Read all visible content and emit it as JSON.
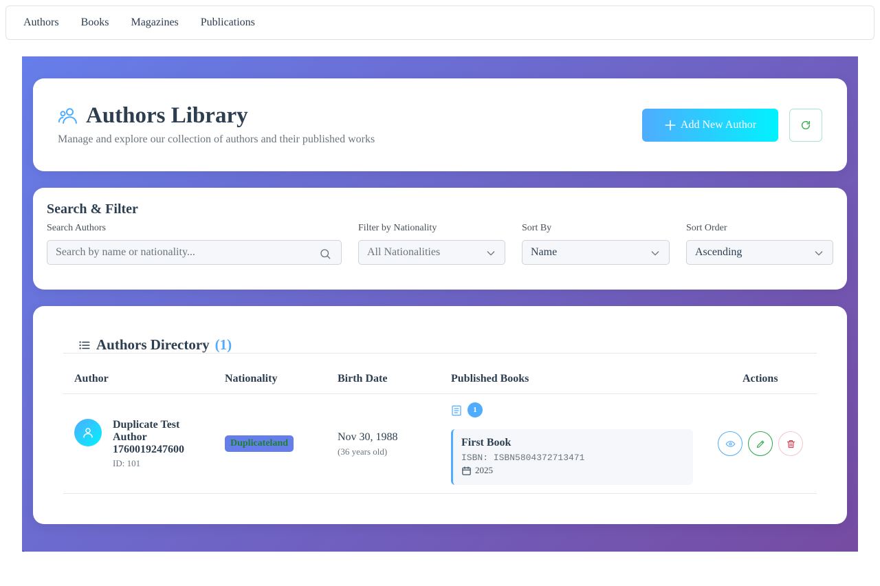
{
  "nav": {
    "items": [
      "Authors",
      "Books",
      "Magazines",
      "Publications"
    ]
  },
  "stray_char": "`",
  "header": {
    "title": "Authors Library",
    "subtitle": "Manage and explore our collection of authors and their published works",
    "add_button": "Add New Author"
  },
  "filters": {
    "title": "Search & Filter",
    "search_label": "Search Authors",
    "search_placeholder": "Search by name or nationality...",
    "nationality_label": "Filter by Nationality",
    "nationality_value": "All Nationalities",
    "sortby_label": "Sort By",
    "sortby_value": "Name",
    "sortorder_label": "Sort Order",
    "sortorder_value": "Ascending"
  },
  "directory": {
    "title": "Authors Directory",
    "count": "(1)",
    "columns": {
      "author": "Author",
      "nationality": "Nationality",
      "birth": "Birth Date",
      "books": "Published Books",
      "actions": "Actions"
    },
    "rows": [
      {
        "name": "Duplicate Test Author 1760019247600",
        "id": "ID: 101",
        "nationality": "Duplicateland",
        "birth_date": "Nov 30, 1988",
        "age": "(36 years old)",
        "book_count": "1",
        "book": {
          "title": "First Book",
          "isbn": "ISBN: ISBN5804372713471",
          "year": "2025"
        }
      }
    ]
  },
  "colors": {
    "gradient_start": "#667eea",
    "gradient_end": "#764ba2",
    "accent": "#4facfe",
    "accent_end": "#00f2fe",
    "success": "#28a745",
    "danger": "#dc3545"
  },
  "icons": [
    "users-icon",
    "plus-icon",
    "refresh-icon",
    "search-icon",
    "chevron-down-icon",
    "list-icon",
    "user-icon",
    "book-icon",
    "calendar-icon",
    "eye-icon",
    "pencil-icon",
    "trash-icon"
  ]
}
